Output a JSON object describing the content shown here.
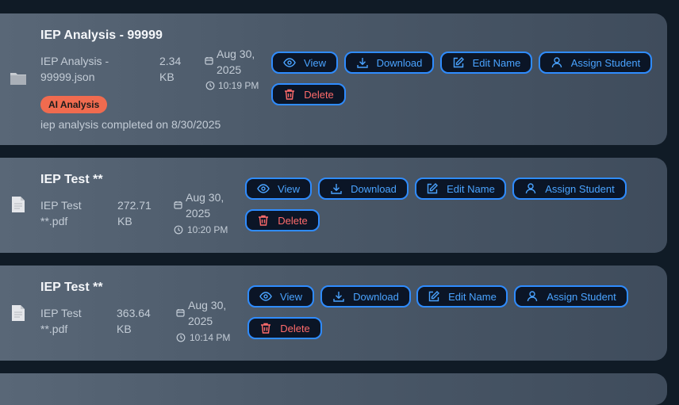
{
  "files": [
    {
      "title": "IEP Analysis - 99999",
      "filename_line1": "IEP Analysis -",
      "filename_line2": "99999.json",
      "size_value": "2.34",
      "size_unit": "KB",
      "date_line1": "Aug 30,",
      "date_line2": "2025",
      "time": "10:19 PM",
      "icon": "folder-icon",
      "badge": "AI Analysis",
      "description": "iep analysis completed on 8/30/2025"
    },
    {
      "title": "IEP Test **",
      "filename_line1": "IEP Test",
      "filename_line2": "**.pdf",
      "size_value": "272.71",
      "size_unit": "KB",
      "date_line1": "Aug 30,",
      "date_line2": "2025",
      "time": "10:20 PM",
      "icon": "document-icon"
    },
    {
      "title": "IEP Test **",
      "filename_line1": "IEP Test",
      "filename_line2": "**.pdf",
      "size_value": "363.64",
      "size_unit": "KB",
      "date_line1": "Aug 30,",
      "date_line2": "2025",
      "time": "10:14 PM",
      "icon": "document-icon"
    }
  ],
  "actions": {
    "view": "View",
    "download": "Download",
    "edit_name": "Edit Name",
    "assign_student": "Assign Student",
    "delete": "Delete"
  },
  "colors": {
    "page_bg": "#101b26",
    "button_border": "#2f8cff",
    "button_text": "#4aa3ff",
    "danger_text": "#ff6b6b",
    "badge_bg": "#f06b4f"
  }
}
